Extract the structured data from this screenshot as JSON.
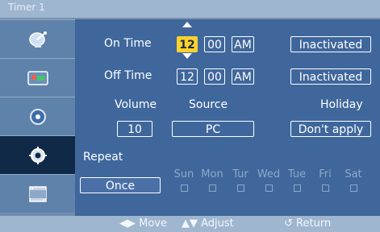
{
  "title": "Timer 1",
  "colors": {
    "accent": "#ffd12d",
    "main_bg": "#3f679c",
    "sidebar_active_bg": "#0f2946"
  },
  "sidebar": {
    "items": [
      {
        "icon": "satellite-dish-icon"
      },
      {
        "icon": "picture-icon"
      },
      {
        "icon": "sound-icon"
      },
      {
        "icon": "gear-icon",
        "active": true
      },
      {
        "icon": "film-icon"
      }
    ]
  },
  "on_time": {
    "label": "On Time",
    "hour": "12",
    "minute": "00",
    "ampm": "AM",
    "status": "Inactivated"
  },
  "off_time": {
    "label": "Off Time",
    "hour": "12",
    "minute": "00",
    "ampm": "AM",
    "status": "Inactivated"
  },
  "settings": {
    "volume_label": "Volume",
    "volume_value": "10",
    "source_label": "Source",
    "source_value": "PC",
    "holiday_label": "Holiday",
    "holiday_value": "Don't apply"
  },
  "repeat": {
    "label": "Repeat",
    "value": "Once",
    "days": [
      "Sun",
      "Mon",
      "Tur",
      "Wed",
      "Tue",
      "Fri",
      "Sat"
    ]
  },
  "footer": {
    "move": "Move",
    "adjust": "Adjust",
    "return": "Return"
  }
}
